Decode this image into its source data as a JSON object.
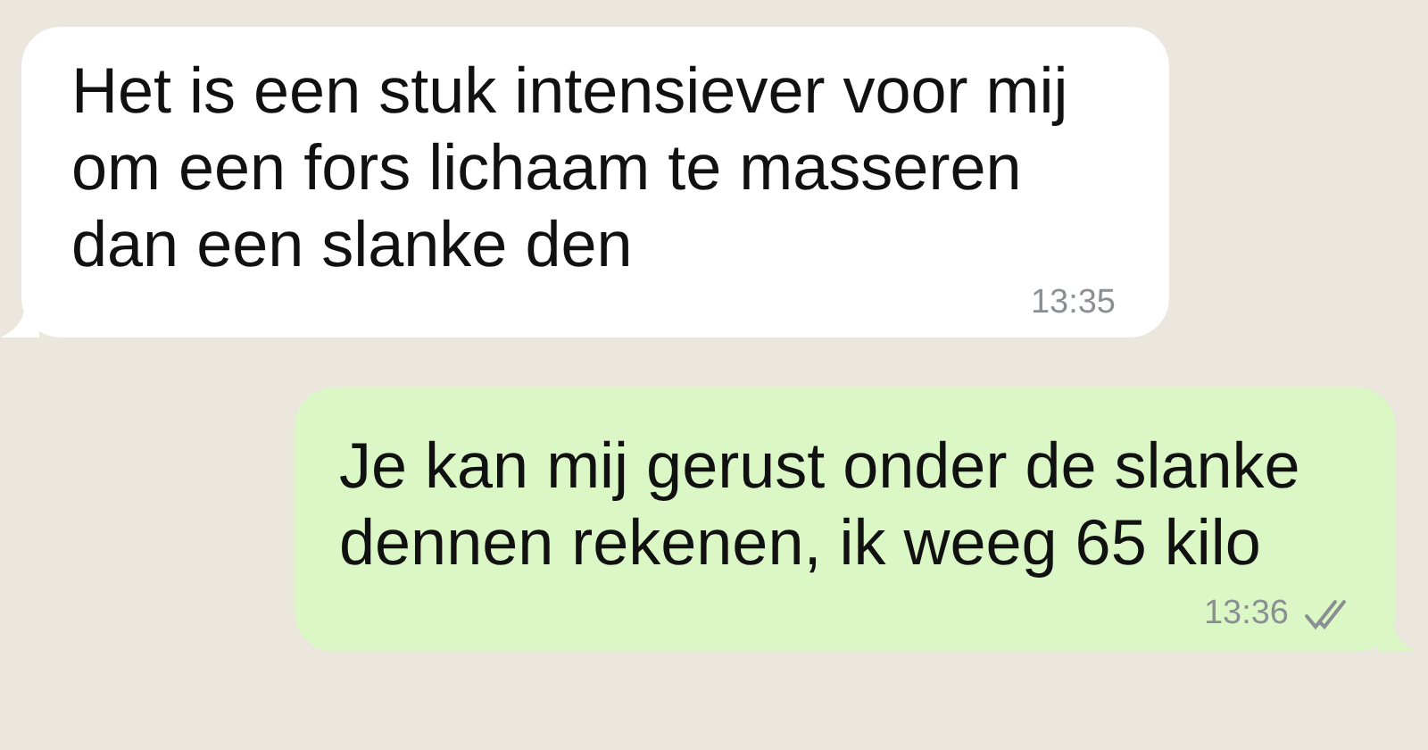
{
  "messages": [
    {
      "outgoing": false,
      "text": "Het is een stuk intensiever voor mij om een fors lichaam te masseren dan een slanke den",
      "time": "13:35"
    },
    {
      "outgoing": true,
      "text": "Je kan mij gerust onder de slanke dennen rekenen, ik weeg 65 kilo",
      "time": "13:36",
      "read": false
    }
  ]
}
